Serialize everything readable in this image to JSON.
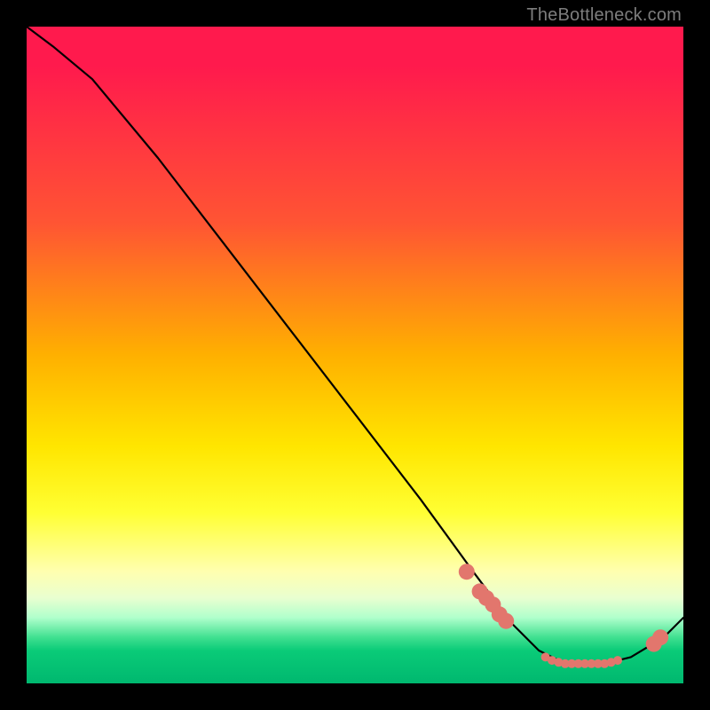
{
  "watermark": "TheBottleneck.com",
  "chart_data": {
    "type": "line",
    "title": "",
    "xlabel": "",
    "ylabel": "",
    "x_range": [
      0,
      100
    ],
    "y_range": [
      0,
      100
    ],
    "series": [
      {
        "name": "curve",
        "x": [
          0,
          4,
          10,
          20,
          30,
          40,
          50,
          60,
          68,
          74,
          78,
          82,
          88,
          92,
          97,
          100
        ],
        "y": [
          100,
          97,
          92,
          80,
          67,
          54,
          41,
          28,
          17,
          9,
          5,
          3,
          3,
          4,
          7,
          10
        ]
      }
    ],
    "markers": [
      {
        "x": 67,
        "y": 17
      },
      {
        "x": 69,
        "y": 14
      },
      {
        "x": 70,
        "y": 13
      },
      {
        "x": 71,
        "y": 12
      },
      {
        "x": 72,
        "y": 10.5
      },
      {
        "x": 73,
        "y": 9.5
      },
      {
        "x": 79,
        "y": 4
      },
      {
        "x": 80,
        "y": 3.5
      },
      {
        "x": 81,
        "y": 3.2
      },
      {
        "x": 82,
        "y": 3
      },
      {
        "x": 83,
        "y": 3
      },
      {
        "x": 84,
        "y": 3
      },
      {
        "x": 85,
        "y": 3
      },
      {
        "x": 86,
        "y": 3
      },
      {
        "x": 87,
        "y": 3
      },
      {
        "x": 88,
        "y": 3
      },
      {
        "x": 89,
        "y": 3.2
      },
      {
        "x": 90,
        "y": 3.5
      },
      {
        "x": 95.5,
        "y": 6
      },
      {
        "x": 96.5,
        "y": 7
      }
    ],
    "curve_color": "#000000",
    "marker_color": "#e2766d",
    "marker_radius_large": 9,
    "marker_radius_small": 5
  }
}
